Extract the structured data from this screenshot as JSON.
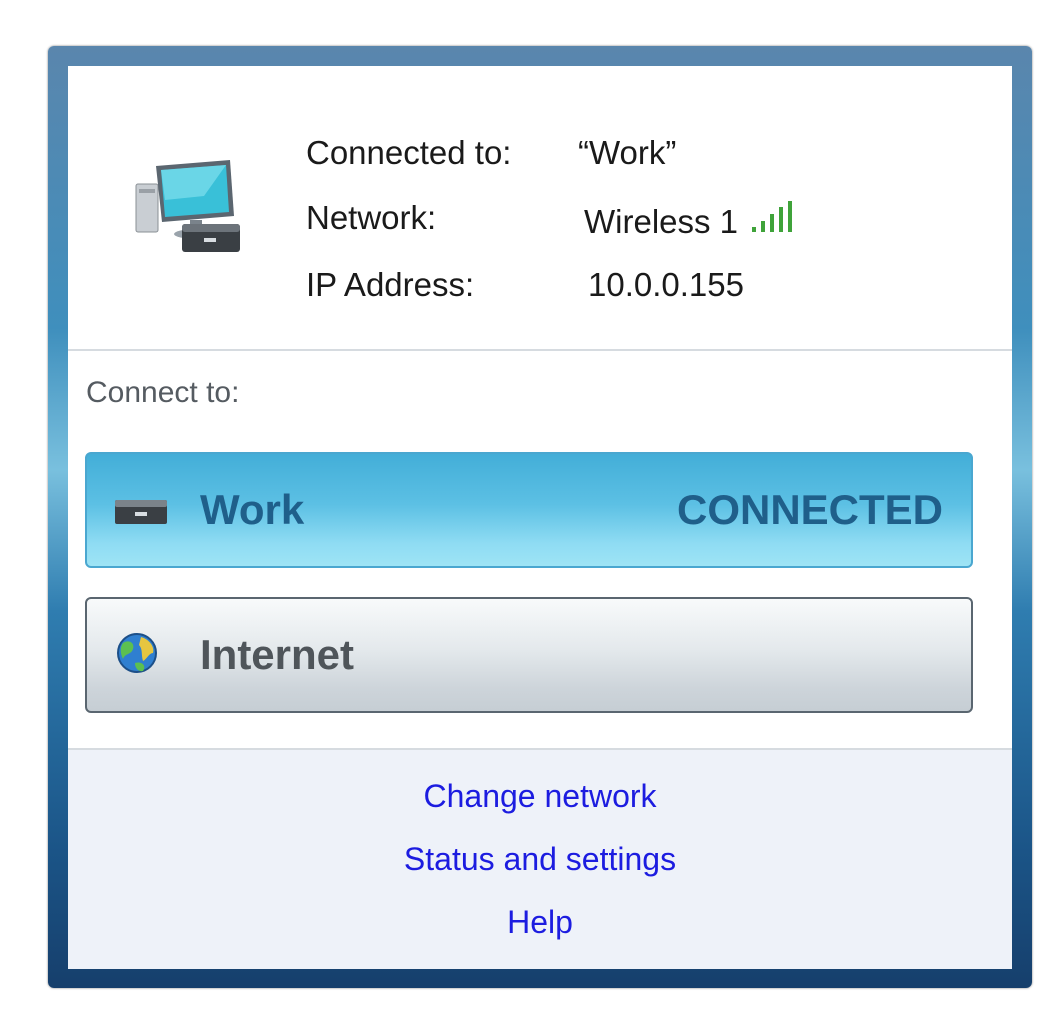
{
  "status": {
    "connected_to_label": "Connected to:",
    "connected_to_value": "“Work”",
    "network_label": "Network:",
    "network_value": "Wireless 1",
    "ip_label": "IP Address:",
    "ip_value": "10.0.0.155",
    "signal_bars": 5,
    "signal_color": "#3fa33a"
  },
  "connect": {
    "label": "Connect to:",
    "options": [
      {
        "name": "Work",
        "status": "CONNECTED",
        "icon": "network-device-icon",
        "accent": "#4fb6df"
      },
      {
        "name": "Internet",
        "status": "",
        "icon": "globe-icon",
        "accent": "#d3d9de"
      }
    ]
  },
  "links": {
    "change_network": "Change network",
    "status_settings": "Status and settings",
    "help": "Help"
  }
}
